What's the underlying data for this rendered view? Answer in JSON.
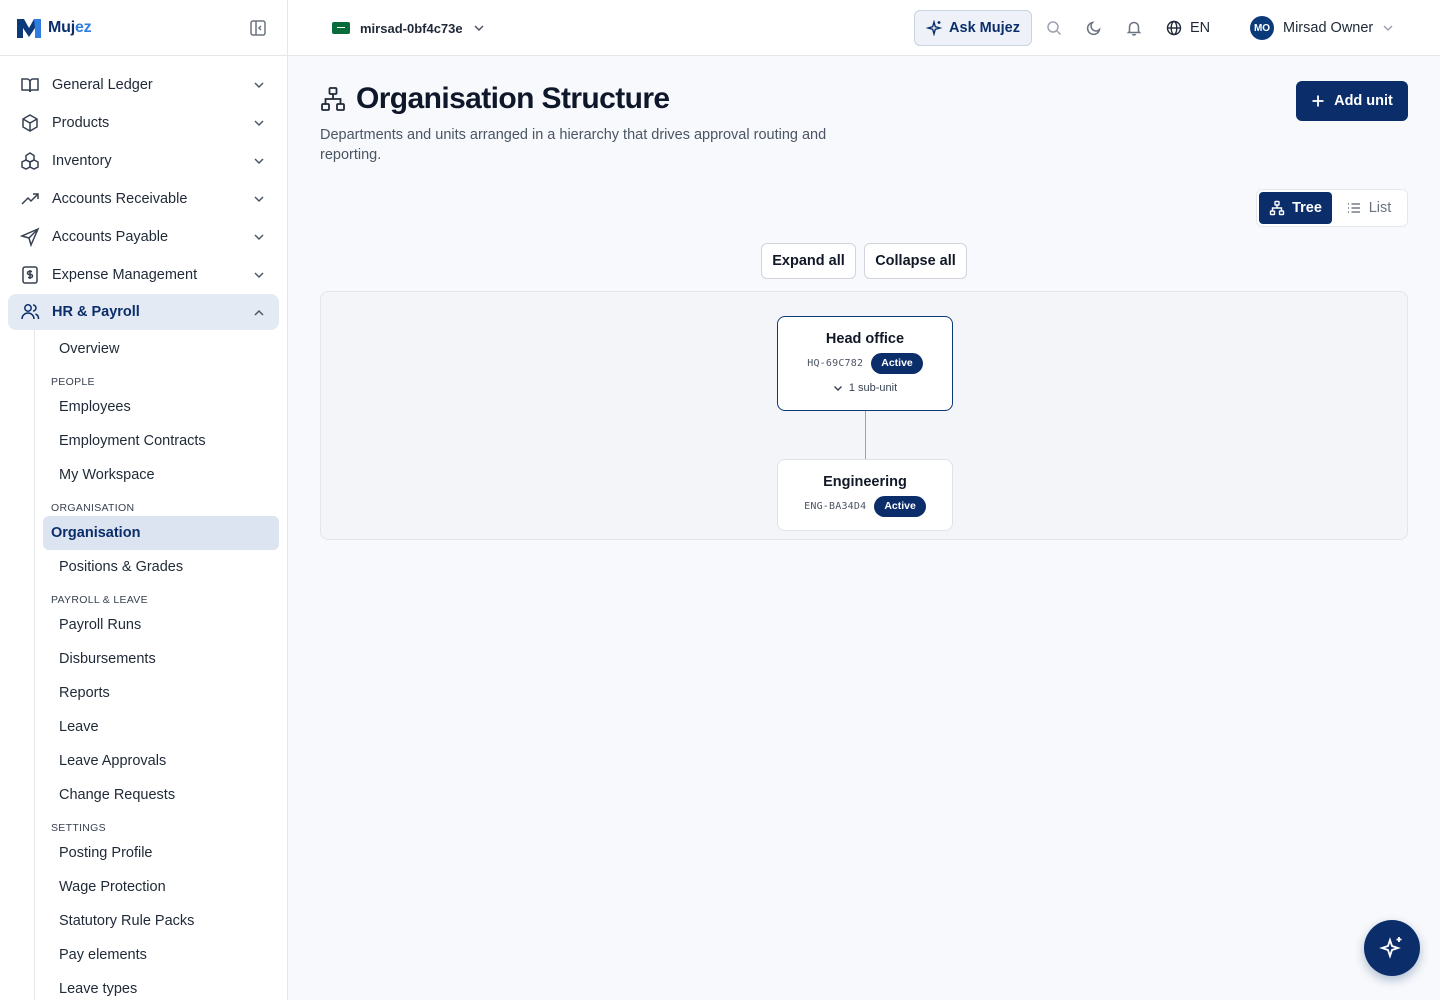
{
  "brand": {
    "name_main": "Muj",
    "name_accent": "ez"
  },
  "topbar": {
    "tenant": "mirsad-0bf4c73e",
    "ask_label": "Ask Mujez",
    "language": "EN",
    "user_initials": "MO",
    "user_name": "Mirsad Owner"
  },
  "sidebar": {
    "items": [
      {
        "label": "General Ledger",
        "icon": "book-icon"
      },
      {
        "label": "Products",
        "icon": "box-icon"
      },
      {
        "label": "Inventory",
        "icon": "boxes-icon"
      },
      {
        "label": "Accounts Receivable",
        "icon": "trending-up-icon"
      },
      {
        "label": "Accounts Payable",
        "icon": "send-icon"
      },
      {
        "label": "Expense Management",
        "icon": "receipt-icon"
      }
    ],
    "active_group": {
      "label": "HR & Payroll",
      "icon": "users-icon"
    },
    "sub": {
      "overview": "Overview",
      "people_heading": "People",
      "employees": "Employees",
      "contracts": "Employment Contracts",
      "workspace": "My Workspace",
      "org_heading": "Organisation",
      "organisation": "Organisation",
      "positions": "Positions & Grades",
      "payroll_heading": "Payroll & Leave",
      "payroll_runs": "Payroll Runs",
      "disbursements": "Disbursements",
      "reports": "Reports",
      "leave": "Leave",
      "leave_approvals": "Leave Approvals",
      "change_requests": "Change Requests",
      "settings_heading": "Settings",
      "posting_profile": "Posting Profile",
      "wage_protection": "Wage Protection",
      "statutory": "Statutory Rule Packs",
      "pay_elements": "Pay elements",
      "leave_types": "Leave types"
    }
  },
  "page": {
    "title": "Organisation Structure",
    "description": "Departments and units arranged in a hierarchy that drives approval routing and reporting.",
    "add_label": "Add unit",
    "view_tree": "Tree",
    "view_list": "List",
    "expand_all": "Expand all",
    "collapse_all": "Collapse all"
  },
  "tree": {
    "root": {
      "name": "Head office",
      "code": "HQ-69C782",
      "status": "Active",
      "subunits": "1 sub-unit"
    },
    "child": {
      "name": "Engineering",
      "code": "ENG-BA34D4",
      "status": "Active"
    }
  },
  "colors": {
    "primary": "#0b2e6b",
    "accent": "#2f7de1",
    "background": "#f7f9fc"
  }
}
